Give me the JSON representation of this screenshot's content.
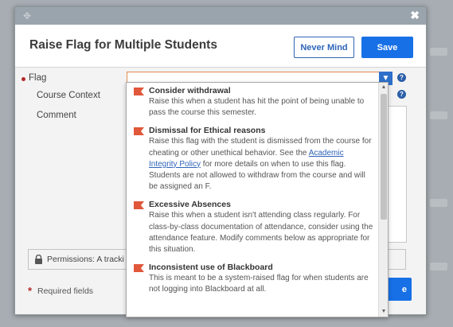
{
  "dialog": {
    "title": "Raise Flag for Multiple Students",
    "close_glyph": "✖",
    "never_mind_label": "Never Mind",
    "save_label": "Save"
  },
  "form": {
    "flag_label": "Flag",
    "course_context_label": "Course Context",
    "comment_label": "Comment",
    "flag_value": "",
    "help_glyph": "?"
  },
  "permissions": {
    "text": "Permissions: A tracki"
  },
  "footer": {
    "required_marker": "*",
    "required_text": "Required fields",
    "partial_button_label": "e"
  },
  "dropdown": {
    "options": [
      {
        "title": "Consider withdrawal",
        "description": "Raise this when a student has hit the point of being unable to pass the course this semester."
      },
      {
        "title": "Dismissal for Ethical reasons",
        "description_before": "Raise this flag with the student is dismissed from the course for cheating or other unethical behavior. See the ",
        "link_text": "Academic Integrity Policy",
        "description_after": " for more details on when to use this flag. Students are not allowed to withdraw from the course and will be assigned an F."
      },
      {
        "title": "Excessive Absences",
        "description": "Raise this when a student isn't attending class regularly. For class-by-class documentation of attendance, consider using the attendance feature. Modify comments below as appropriate for this situation."
      },
      {
        "title": "Inconsistent use of Blackboard",
        "description": "This is meant to be a system-raised flag for when students are not logging into Blackboard at all."
      }
    ]
  },
  "colors": {
    "flag_icon": "#e0573a",
    "primary_button": "#1770e6",
    "link": "#2f64b8",
    "required": "#b52a2a"
  }
}
